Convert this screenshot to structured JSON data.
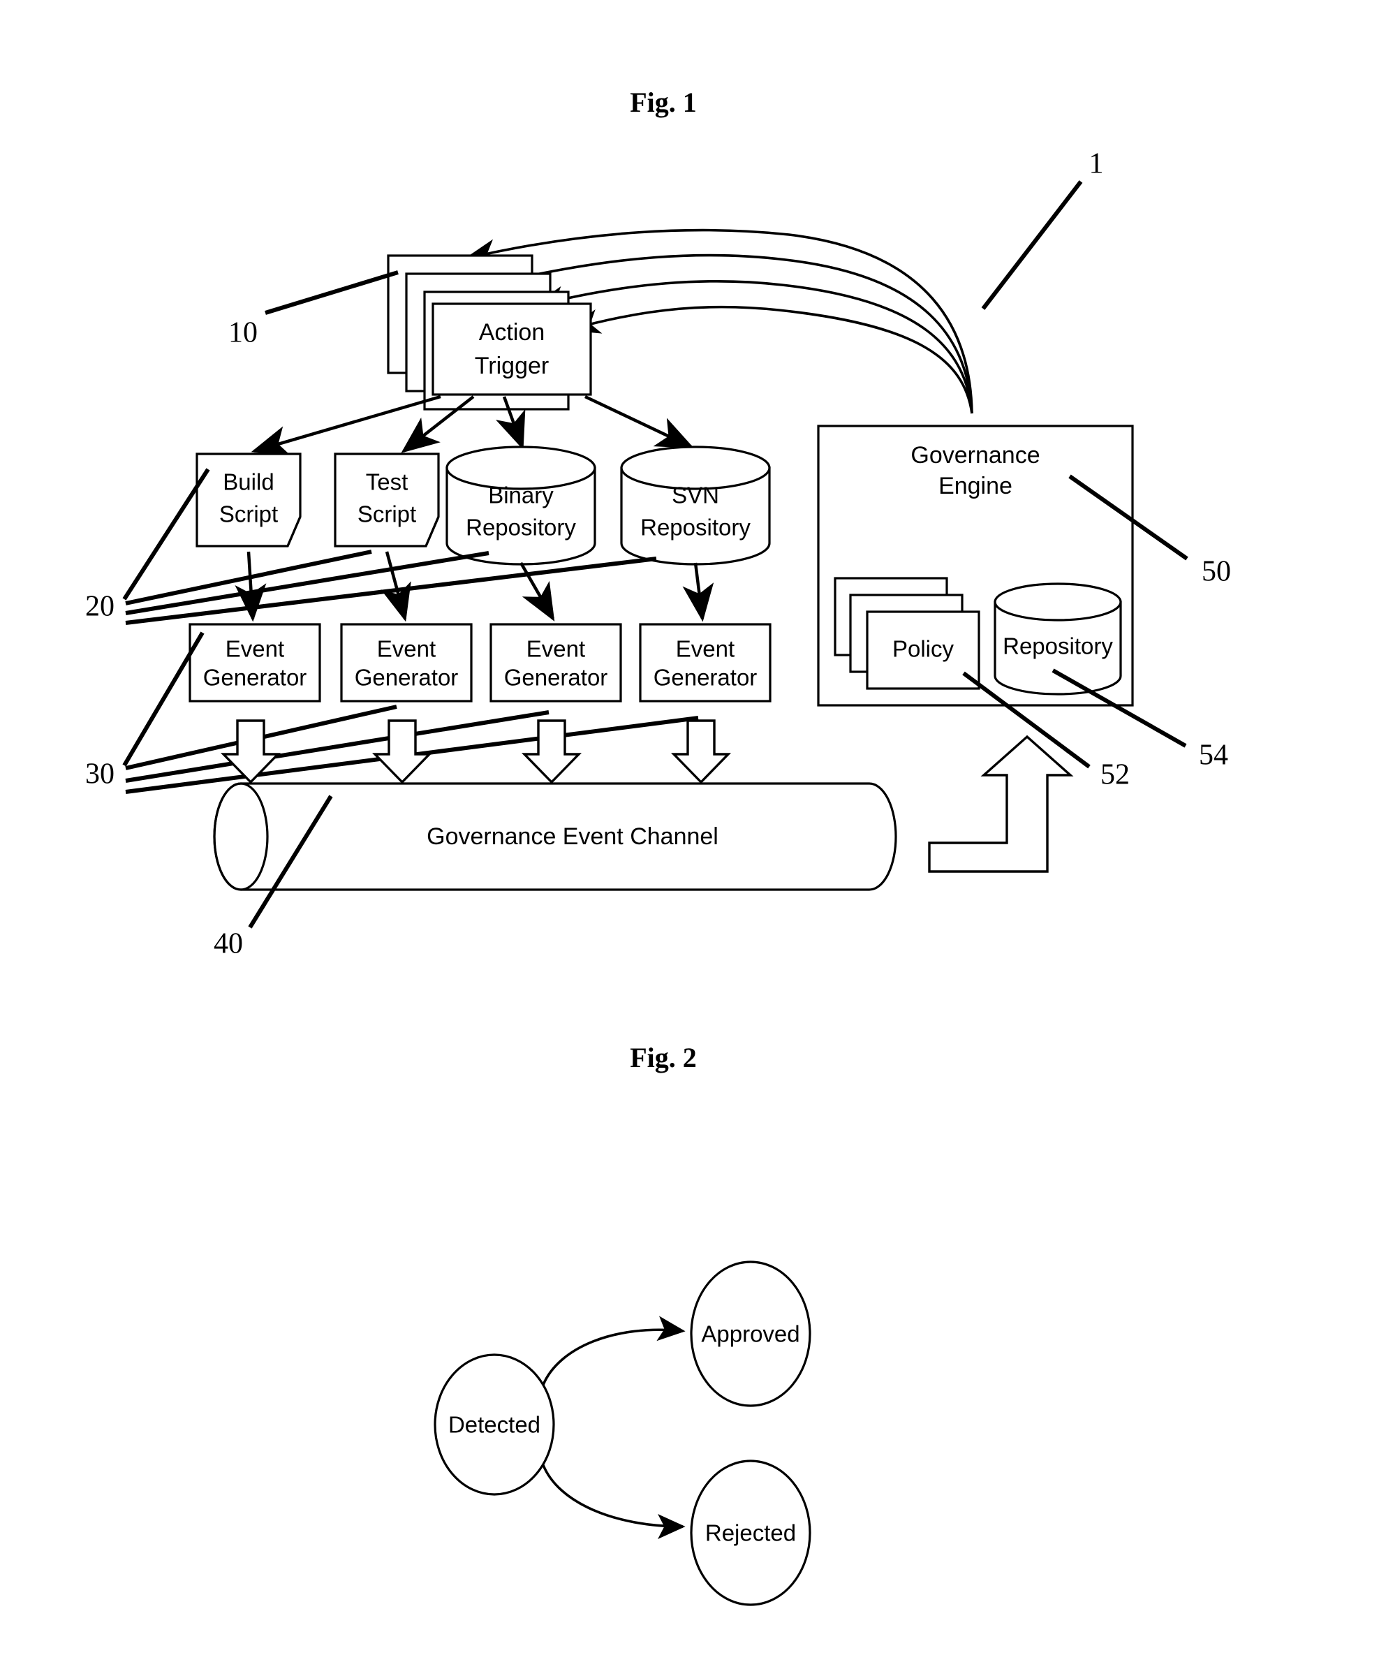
{
  "document": {
    "type": "patent-figure-sheet"
  },
  "figures": [
    {
      "id": "fig1",
      "title": "Fig. 1",
      "overall_ref": "1",
      "nodes": {
        "action_trigger": {
          "label_line1": "Action",
          "label_line2": "Trigger",
          "ref": "10",
          "stack_count": 4
        },
        "build_script": {
          "label_line1": "Build",
          "label_line2": "Script"
        },
        "test_script": {
          "label_line1": "Test",
          "label_line2": "Script"
        },
        "binary_repository": {
          "label_line1": "Binary",
          "label_line2": "Repository"
        },
        "svn_repository": {
          "label_line1": "SVN",
          "label_line2": "Repository"
        },
        "event_generator_1": {
          "label_line1": "Event",
          "label_line2": "Generator"
        },
        "event_generator_2": {
          "label_line1": "Event",
          "label_line2": "Generator"
        },
        "event_generator_3": {
          "label_line1": "Event",
          "label_line2": "Generator"
        },
        "event_generator_4": {
          "label_line1": "Event",
          "label_line2": "Generator"
        },
        "governance_event_channel": {
          "label": "Governance Event Channel",
          "ref": "40"
        },
        "governance_engine": {
          "label_line1": "Governance",
          "label_line2": "Engine",
          "ref": "50"
        },
        "policy": {
          "label": "Policy",
          "ref": "52",
          "stack_count": 3
        },
        "repository": {
          "label": "Repository",
          "ref": "54"
        }
      },
      "ref_numerals": {
        "sources_group": "20",
        "generators_group": "30"
      }
    },
    {
      "id": "fig2",
      "title": "Fig. 2",
      "states": [
        {
          "id": "detected",
          "label": "Detected"
        },
        {
          "id": "approved",
          "label": "Approved"
        },
        {
          "id": "rejected",
          "label": "Rejected"
        }
      ],
      "transitions": [
        {
          "from": "detected",
          "to": "approved"
        },
        {
          "from": "detected",
          "to": "rejected"
        }
      ]
    }
  ]
}
